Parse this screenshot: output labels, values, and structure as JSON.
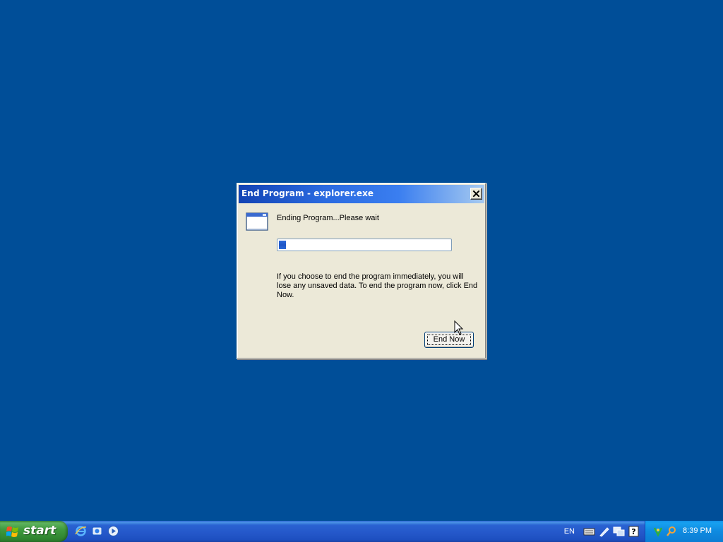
{
  "dialog": {
    "title": "End Program - explorer.exe",
    "status_text": "Ending Program...Please wait",
    "progress_percent": 4,
    "info_text": "If you choose to end the program immediately, you will lose any unsaved data. To end the program now, click End Now.",
    "end_now_label": "End Now",
    "icon": "window-icon",
    "close_icon": "close-icon"
  },
  "taskbar": {
    "start_label": "start",
    "quick_launch": [
      "internet-explorer-icon",
      "outlook-express-icon",
      "media-player-icon"
    ],
    "language": "EN",
    "tray_icons": [
      "keyboard-icon",
      "pen-icon",
      "network-icon",
      "help-icon",
      "safely-remove-icon",
      "search-icon"
    ],
    "clock": "8:39 PM"
  },
  "colors": {
    "desktop": "#004e98",
    "taskbar": "#2457c9",
    "start_button": "#3f9a3f",
    "tray": "#0f8ae0",
    "dialog_face": "#ece9d8",
    "progress_fill": "#1e55c6"
  }
}
